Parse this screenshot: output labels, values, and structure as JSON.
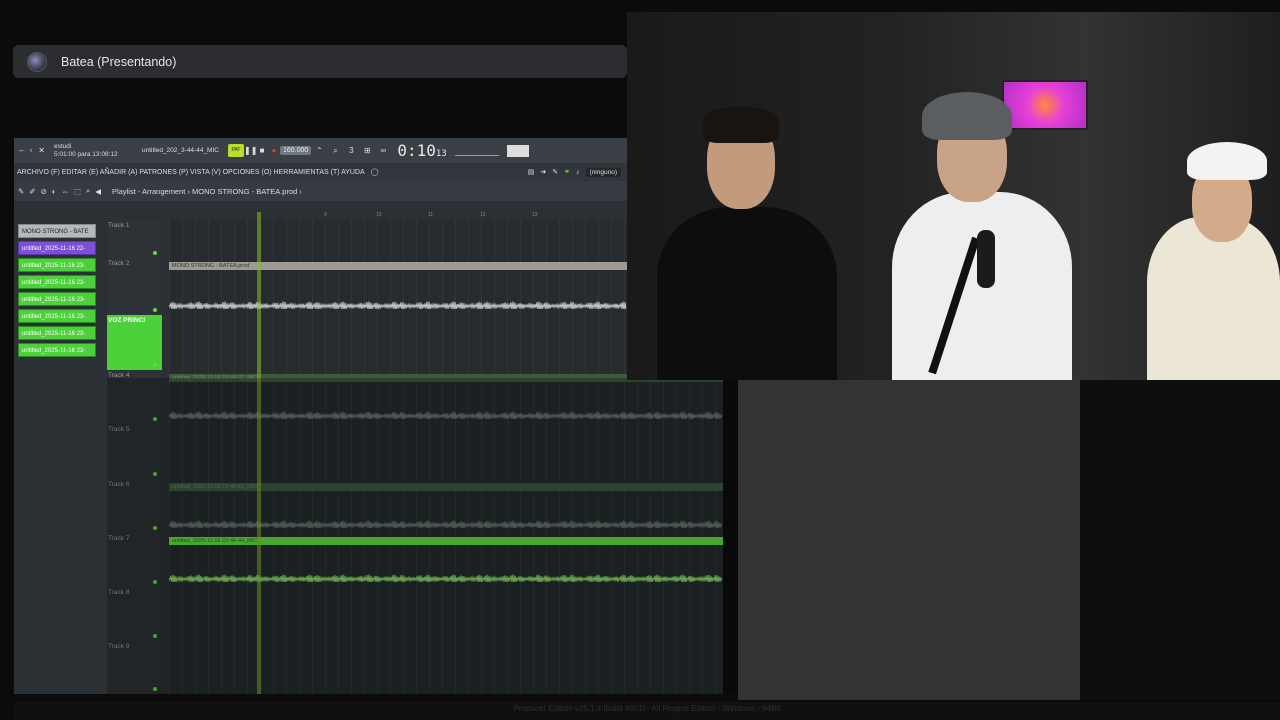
{
  "presenting": {
    "label": "Batea (Presentando)"
  },
  "toolbar": {
    "user": "estudi",
    "time_info": "5:01:00 para 13:08:12",
    "project": "untitled_202_3-44-44_MIC",
    "pattern_btn": "PAT",
    "bpm": "160.000",
    "time_main": "0:10",
    "time_small": "13",
    "icons": [
      "minimize-icon",
      "restore-icon",
      "close-icon"
    ]
  },
  "menubar": {
    "menus": "ARCHIVO (F) EDITAR (E) AÑADIR (A) PATRONES (P) VISTA (V) OPCIONES (O) HERRAMIENTAS (T) AYUDA",
    "none_select": "(ninguno)"
  },
  "playlist": {
    "title": "Playlist - Arrangement › MONO STRONG - BATEA.prod ›",
    "ruler_numbers": [
      "9",
      "10",
      "11",
      "12",
      "13"
    ]
  },
  "patterns": [
    "MONO STRONG - BATE",
    "untitled_2025-11-16 22-",
    "untitled_2025-11-16 23-",
    "untitled_2025-11-16 23-",
    "untitled_2025-11-16 23-",
    "untitled_2025-11-16 23-",
    "untitled_2025-11-16 23-",
    "untitled_2025-11-16 23-"
  ],
  "tracks": [
    {
      "label": "Track 1"
    },
    {
      "label": "Track 2",
      "clip": "MONO STRONG - BATEA.prod"
    },
    {
      "label": "VOZ PRINCI"
    },
    {
      "label": "Track 4",
      "clip": "untitled_2025-11-16 23-44-32_MIC"
    },
    {
      "label": "Track 5"
    },
    {
      "label": "Track 6",
      "clip": "untitled_2025-11-16 23-45-15_MIC"
    },
    {
      "label": "Track 7",
      "clip": "untitled_2025-11-16 23-46-44_MIC"
    },
    {
      "label": "Track 8"
    },
    {
      "label": "Track 9"
    }
  ],
  "status": "Producer Edition v25.1.4 [build 4951] - All Plugins Edition - Windows - 64Bit",
  "colors": {
    "accent_green": "#4cd13b",
    "clip_green": "#5ee03c",
    "playhead": "#a6d63a"
  }
}
